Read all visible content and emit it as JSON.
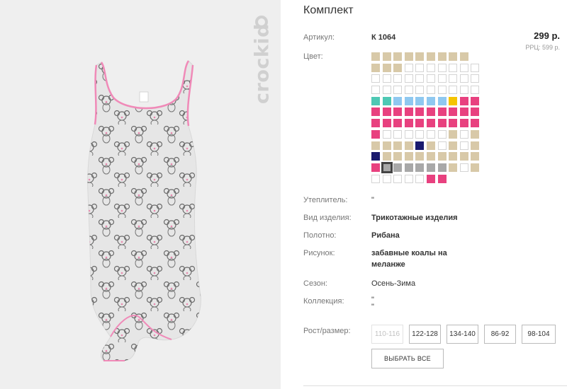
{
  "product": {
    "title": "Комплект",
    "brand_text": "crockid",
    "price": "299 р.",
    "rrp": "РРЦ: 599 р."
  },
  "attributes": {
    "article_label": "Артикул:",
    "article_value": "К 1064",
    "color_label": "Цвет:",
    "insulation_label": "Утеплитель:",
    "insulation_value": "\"",
    "type_label": "Вид изделия:",
    "type_value": "Трикотажные изделия",
    "fabric_label": "Полотно:",
    "fabric_value": "Рибана",
    "pattern_label": "Рисунок:",
    "pattern_value_line1": "забавные коалы на",
    "pattern_value_line2": "меланже",
    "season_label": "Сезон:",
    "season_value": "Осень-Зима",
    "collection_label": "Коллекция:",
    "collection_value_line1": "\"",
    "collection_value_line2": "\""
  },
  "swatch_colors": {
    "beige": "#d8c9a8",
    "empty": "#ffffff",
    "teal": "#4ec8b4",
    "lightblue": "#8fc8f0",
    "yellow": "#f5c400",
    "pink": "#e8417f",
    "navy": "#1a1a6e",
    "grey": "#a8a8a8"
  },
  "swatch_rows": [
    [
      "beige",
      "beige",
      "beige",
      "beige",
      "beige",
      "beige",
      "beige",
      "beige",
      "beige"
    ],
    [
      "beige",
      "beige",
      "beige",
      "empty",
      "empty",
      "empty",
      "empty",
      "empty",
      "empty",
      "empty"
    ],
    [
      "empty",
      "empty",
      "empty",
      "empty",
      "empty",
      "empty",
      "empty",
      "empty",
      "empty",
      "empty"
    ],
    [
      "empty",
      "empty",
      "empty",
      "empty",
      "empty",
      "empty",
      "empty",
      "empty",
      "empty",
      "empty"
    ],
    [
      "teal",
      "teal",
      "lightblue",
      "lightblue",
      "lightblue",
      "lightblue",
      "lightblue",
      "yellow",
      "pink",
      "pink"
    ],
    [
      "pink",
      "pink",
      "pink",
      "pink",
      "pink",
      "pink",
      "pink",
      "pink",
      "pink",
      "pink"
    ],
    [
      "pink",
      "pink",
      "pink",
      "pink",
      "pink",
      "pink",
      "pink",
      "pink",
      "pink",
      "pink"
    ],
    [
      "pink",
      "empty",
      "empty",
      "empty",
      "empty",
      "empty",
      "empty",
      "beige",
      "empty",
      "beige"
    ],
    [
      "beige",
      "beige",
      "beige",
      "beige",
      "navy",
      "beige",
      "empty",
      "beige",
      "empty",
      "beige"
    ],
    [
      "navy",
      "beige",
      "beige",
      "beige",
      "beige",
      "beige",
      "beige",
      "beige",
      "beige",
      "beige"
    ],
    [
      "pink",
      "grey",
      "grey",
      "grey",
      "grey",
      "grey",
      "grey",
      "beige",
      "empty",
      "beige"
    ],
    [
      "empty",
      "empty",
      "empty",
      "empty",
      "empty",
      "pink",
      "pink"
    ]
  ],
  "selected_swatch": [
    10,
    1
  ],
  "size": {
    "label": "Рост/размер:",
    "options": [
      "110-116",
      "122-128",
      "134-140",
      "86-92",
      "98-104"
    ],
    "disabled": [
      "110-116"
    ],
    "select_all": "ВЫБРАТЬ ВСЕ"
  }
}
